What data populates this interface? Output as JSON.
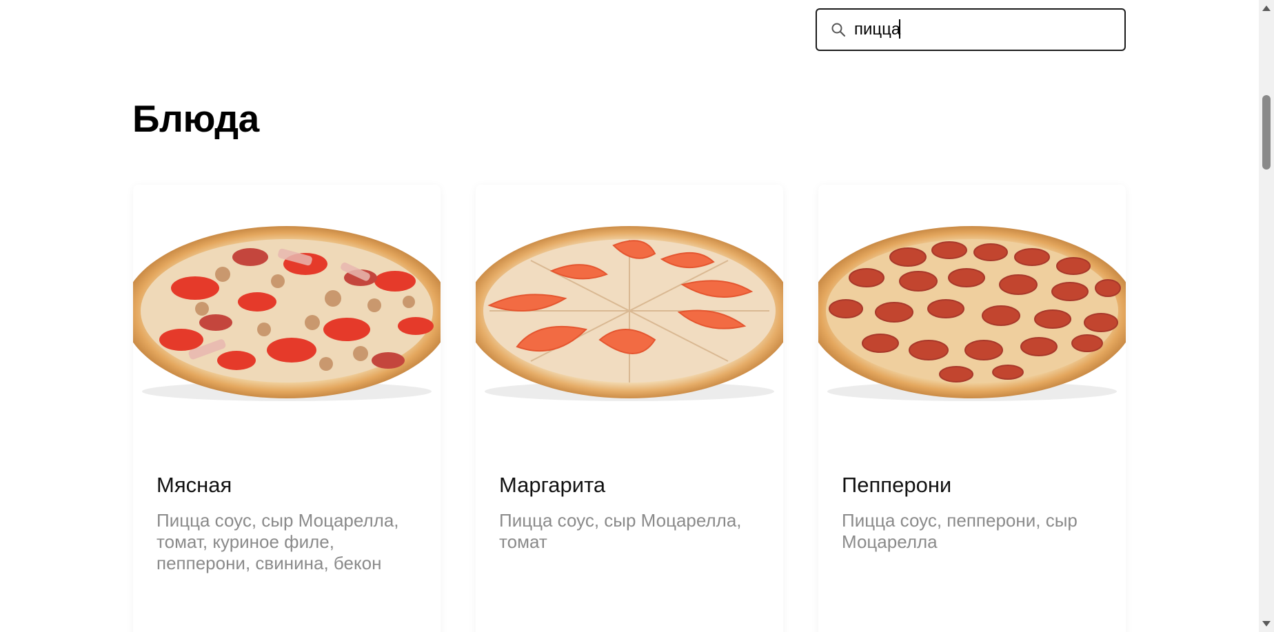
{
  "search": {
    "value": "пицца",
    "icon": "search-icon"
  },
  "section": {
    "title": "Блюда"
  },
  "dishes": [
    {
      "name": "Мясная",
      "description": "Пицца соус, сыр Моцарелла, томат, куриное филе, пепперони, свинина, бекон",
      "image": "meat-pizza-image"
    },
    {
      "name": "Маргарита",
      "description": "Пицца соус, сыр Моцарелла, томат",
      "image": "margherita-pizza-image"
    },
    {
      "name": "Пепперони",
      "description": "Пицца соус, пепперони, сыр Моцарелла",
      "image": "pepperoni-pizza-image"
    }
  ],
  "colors": {
    "text": "#000000",
    "muted": "#8a8a8a",
    "crust": "#e0a45c",
    "tomato": "#e8432e",
    "pepperoni": "#c0392b",
    "cheese": "#f3e2c4"
  }
}
